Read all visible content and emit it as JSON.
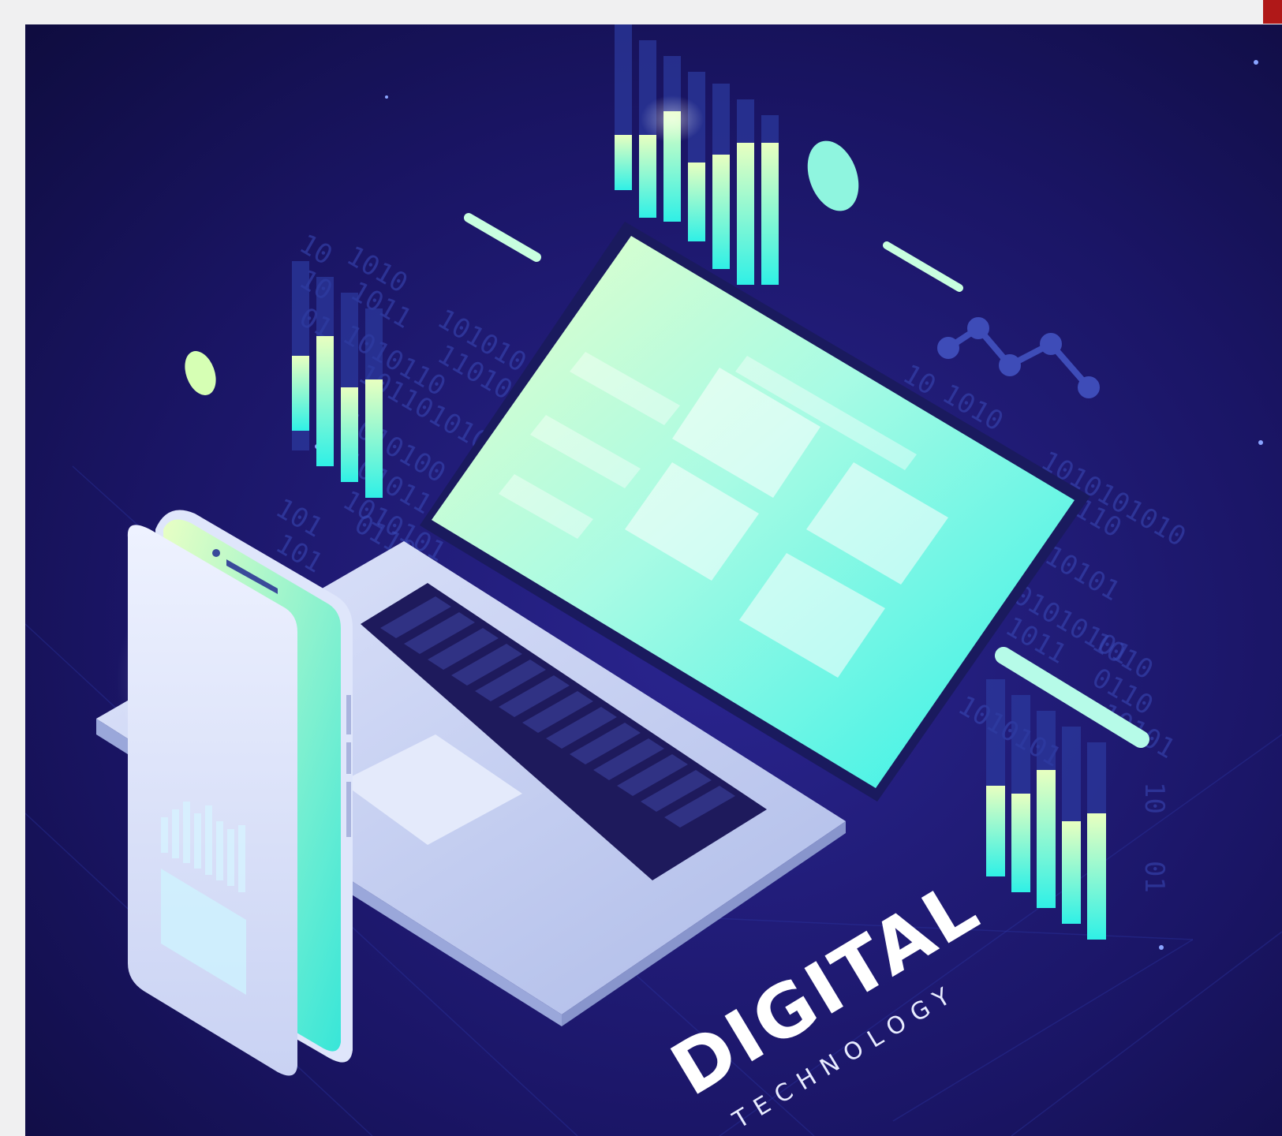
{
  "illustration": {
    "headline": "DIGITAL",
    "subheadline": "TECHNOLOGY",
    "binary_strings": [
      "10",
      "1010",
      "10",
      "1011",
      "01",
      "101010",
      "11010",
      "1010110",
      "1011010101",
      "1010100",
      "101011",
      "1010101",
      "101",
      "0110",
      "101",
      "10",
      "1010",
      "1010101010",
      "0110",
      "10101",
      "01010101",
      "1011",
      "1010",
      "0110",
      "10101",
      "1010101",
      "10",
      "01"
    ],
    "colors": {
      "background": "#13104a",
      "accent_cyan": "#2ff0e6",
      "accent_lime": "#d8ffb0",
      "device_body": "#c9d3f2",
      "brand_accent": "#b01818"
    }
  }
}
